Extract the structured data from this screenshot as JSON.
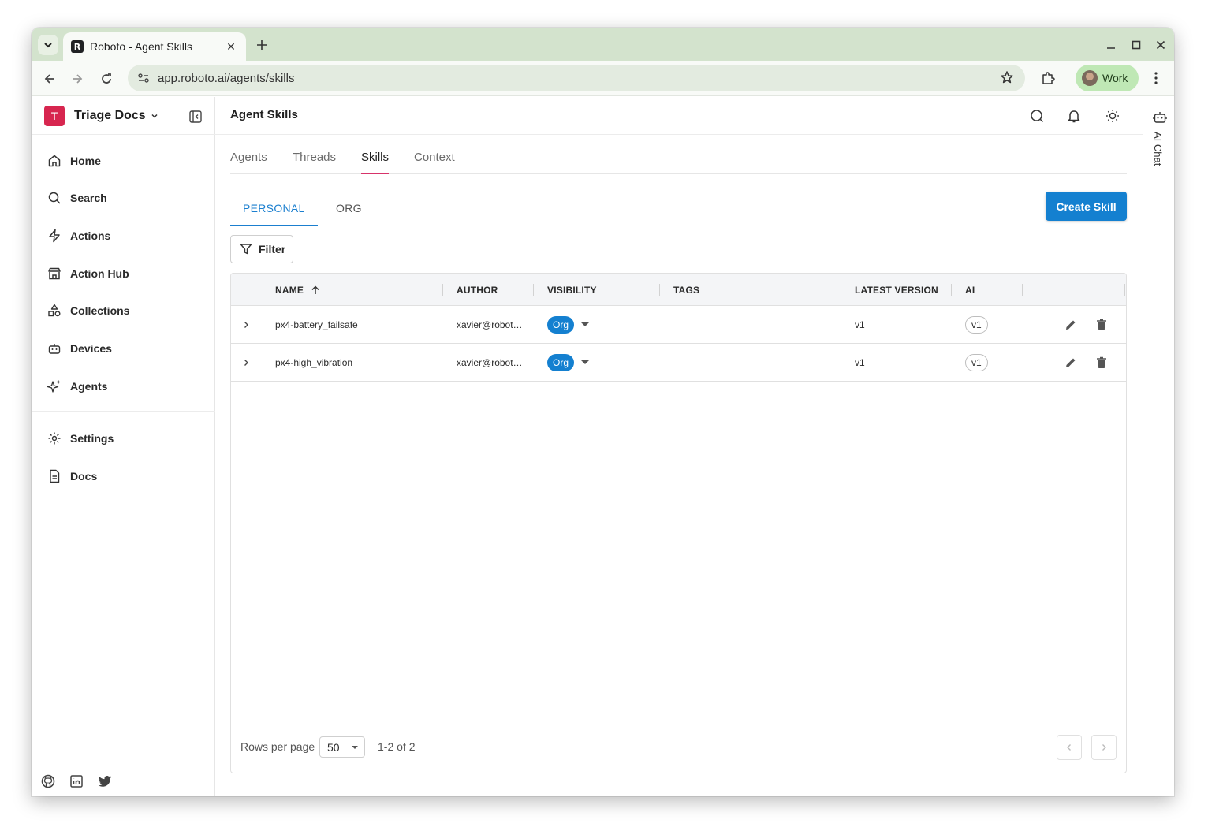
{
  "browser": {
    "tab_title": "Roboto - Agent Skills",
    "favicon_letter": "R",
    "url": "app.roboto.ai/agents/skills",
    "profile_label": "Work"
  },
  "sidebar": {
    "workspace_initial": "T",
    "workspace_name": "Triage Docs",
    "items": [
      {
        "label": "Home",
        "icon": "home-icon"
      },
      {
        "label": "Search",
        "icon": "search-icon"
      },
      {
        "label": "Actions",
        "icon": "bolt-icon"
      },
      {
        "label": "Action Hub",
        "icon": "store-icon"
      },
      {
        "label": "Collections",
        "icon": "shapes-icon"
      },
      {
        "label": "Devices",
        "icon": "robot-icon"
      },
      {
        "label": "Agents",
        "icon": "sparkles-icon"
      }
    ],
    "bottom_items": [
      {
        "label": "Settings",
        "icon": "gear-icon"
      },
      {
        "label": "Docs",
        "icon": "document-icon"
      }
    ],
    "social": [
      "github-icon",
      "linkedin-icon",
      "twitter-icon"
    ]
  },
  "header": {
    "title": "Agent Skills"
  },
  "top_tabs": [
    "Agents",
    "Threads",
    "Skills",
    "Context"
  ],
  "top_tabs_active": "Skills",
  "sub_tabs": [
    "PERSONAL",
    "ORG"
  ],
  "sub_tabs_active": "PERSONAL",
  "create_button": "Create Skill",
  "filter_button": "Filter",
  "table": {
    "columns": [
      "NAME",
      "AUTHOR",
      "VISIBILITY",
      "TAGS",
      "LATEST VERSION",
      "AI"
    ],
    "sort": {
      "column": "NAME",
      "direction": "ascending"
    },
    "rows": [
      {
        "name": "px4-battery_failsafe",
        "author": "xavier@robot…",
        "visibility": "Org",
        "tags": "",
        "latest_version": "v1",
        "ai": "v1"
      },
      {
        "name": "px4-high_vibration",
        "author": "xavier@robot…",
        "visibility": "Org",
        "tags": "",
        "latest_version": "v1",
        "ai": "v1"
      }
    ]
  },
  "pagination": {
    "rows_per_page_label": "Rows per page",
    "rows_per_page": "50",
    "range": "1-2 of 2"
  },
  "ai_chat": {
    "label": "AI Chat"
  },
  "colors": {
    "accent_blue": "#1480d0",
    "tab_underline": "#d7336a",
    "workspace_badge": "#d7264f",
    "browser_frame": "#d3e3cd"
  }
}
